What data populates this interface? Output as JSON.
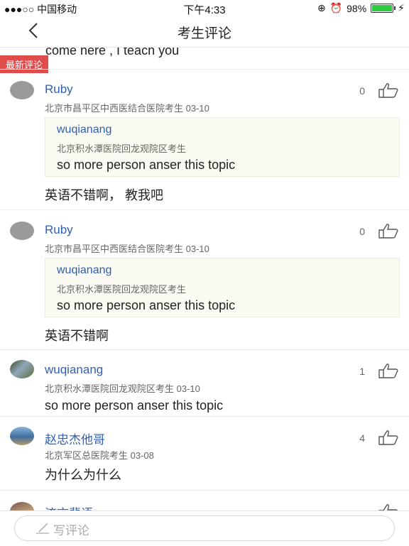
{
  "status": {
    "carrier": "●●●○○ 中国移动",
    "time": "下午4:33",
    "battery": "98%",
    "battery_level": 0.98
  },
  "nav": {
    "title": "考生评论",
    "back_icon": "chevron-left-icon"
  },
  "partial_text": "come here , I teach you",
  "latest_label": "最新评论",
  "comments": [
    {
      "name": "Ruby",
      "meta": "北京市昌平区中西医结合医院考生 03-10",
      "likes": "0",
      "quote": {
        "name": "wuqianang",
        "meta": "北京积水潭医院回龙观院区考生",
        "text": "so more person anser this topic"
      },
      "text": "英语不错啊， 教我吧"
    },
    {
      "name": "Ruby",
      "meta": "北京市昌平区中西医结合医院考生 03-10",
      "likes": "0",
      "quote": {
        "name": "wuqianang",
        "meta": "北京积水潭医院回龙观院区考生",
        "text": "so more person anser this topic"
      },
      "text": "英语不错啊"
    },
    {
      "name": "wuqianang",
      "meta": "北京积水潭医院回龙观院区考生 03-10",
      "likes": "1",
      "text": "so more person anser this topic"
    },
    {
      "name": "赵忠杰他哥",
      "meta": "北京军区总医院考生 03-08",
      "likes": "4",
      "text": "为什么为什么"
    },
    {
      "name": "流言蜚语"
    }
  ],
  "composer": {
    "placeholder": "写评论",
    "icon": "pen-icon"
  }
}
